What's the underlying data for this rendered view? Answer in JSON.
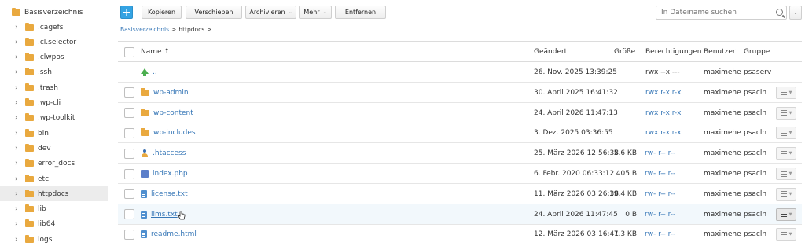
{
  "sidebar": {
    "root": "Basisverzeichnis",
    "items": [
      {
        "label": ".cagefs",
        "selected": false
      },
      {
        "label": ".cl.selector",
        "selected": false
      },
      {
        "label": ".clwpos",
        "selected": false
      },
      {
        "label": ".ssh",
        "selected": false
      },
      {
        "label": ".trash",
        "selected": false
      },
      {
        "label": ".wp-cli",
        "selected": false
      },
      {
        "label": ".wp-toolkit",
        "selected": false
      },
      {
        "label": "bin",
        "selected": false
      },
      {
        "label": "dev",
        "selected": false
      },
      {
        "label": "error_docs",
        "selected": false
      },
      {
        "label": "etc",
        "selected": false
      },
      {
        "label": "httpdocs",
        "selected": true
      },
      {
        "label": "lib",
        "selected": false
      },
      {
        "label": "lib64",
        "selected": false
      },
      {
        "label": "logs",
        "selected": false
      }
    ]
  },
  "toolbar": {
    "add_label": "+",
    "copy_label": "Kopieren",
    "move_label": "Verschieben",
    "archive_label": "Archivieren",
    "more_label": "Mehr",
    "remove_label": "Entfernen",
    "caret": "⌄"
  },
  "search": {
    "placeholder": "In Dateiname suchen",
    "dropdown_caret": "⌄"
  },
  "breadcrumb": {
    "root": "Basisverzeichnis",
    "sep": ">",
    "current": "httpdocs",
    "trail": ">"
  },
  "table": {
    "headers": {
      "name": "Name ↑",
      "modified": "Geändert",
      "size": "Größe",
      "permissions": "Berechtigungen",
      "user": "Benutzer",
      "group": "Gruppe"
    },
    "rows": [
      {
        "icon": "up-arrow-icon",
        "name": "..",
        "modified": "26. Nov. 2025 13:39:25",
        "size": "",
        "permissions": "rwx --x ---",
        "perm_link": false,
        "user": "maximehe",
        "group": "psaserv",
        "checkbox": false,
        "menu": false,
        "underline": false,
        "highlight": false
      },
      {
        "icon": "folder-icon",
        "name": "wp-admin",
        "modified": "30. April 2025 16:41:32",
        "size": "",
        "permissions": "rwx r-x r-x",
        "perm_link": true,
        "user": "maximehe",
        "group": "psacln",
        "checkbox": true,
        "menu": true,
        "underline": false,
        "highlight": false
      },
      {
        "icon": "folder-icon",
        "name": "wp-content",
        "modified": "24. April 2026 11:47:13",
        "size": "",
        "permissions": "rwx r-x r-x",
        "perm_link": true,
        "user": "maximehe",
        "group": "psacln",
        "checkbox": true,
        "menu": true,
        "underline": false,
        "highlight": false
      },
      {
        "icon": "folder-icon",
        "name": "wp-includes",
        "modified": "3. Dez. 2025 03:36:55",
        "size": "",
        "permissions": "rwx r-x r-x",
        "perm_link": true,
        "user": "maximehe",
        "group": "psacln",
        "checkbox": true,
        "menu": true,
        "underline": false,
        "highlight": false
      },
      {
        "icon": "user-file-icon",
        "name": ".htaccess",
        "modified": "25. März 2026 12:56:38",
        "size": "5.6 KB",
        "permissions": "rw- r-- r--",
        "perm_link": true,
        "user": "maximehe",
        "group": "psacln",
        "checkbox": true,
        "menu": true,
        "underline": false,
        "highlight": false
      },
      {
        "icon": "php-file-icon",
        "name": "index.php",
        "modified": "6. Febr. 2020 06:33:12",
        "size": "405 B",
        "permissions": "rw- r-- r--",
        "perm_link": true,
        "user": "maximehe",
        "group": "psacln",
        "checkbox": true,
        "menu": true,
        "underline": false,
        "highlight": false
      },
      {
        "icon": "text-file-icon",
        "name": "license.txt",
        "modified": "11. März 2026 03:26:38",
        "size": "19.4 KB",
        "permissions": "rw- r-- r--",
        "perm_link": true,
        "user": "maximehe",
        "group": "psacln",
        "checkbox": true,
        "menu": true,
        "underline": false,
        "highlight": false
      },
      {
        "icon": "text-file-icon",
        "name": "llms.txt",
        "modified": "24. April 2026 11:47:45",
        "size": "0 B",
        "permissions": "rw- r-- r--",
        "perm_link": true,
        "user": "maximehe",
        "group": "psacln",
        "checkbox": true,
        "menu": true,
        "underline": true,
        "highlight": true
      },
      {
        "icon": "html-file-icon",
        "name": "readme.html",
        "modified": "12. März 2026 03:16:41",
        "size": "7.3 KB",
        "permissions": "rw- r-- r--",
        "perm_link": true,
        "user": "maximehe",
        "group": "psacln",
        "checkbox": true,
        "menu": true,
        "underline": false,
        "highlight": false
      }
    ]
  }
}
